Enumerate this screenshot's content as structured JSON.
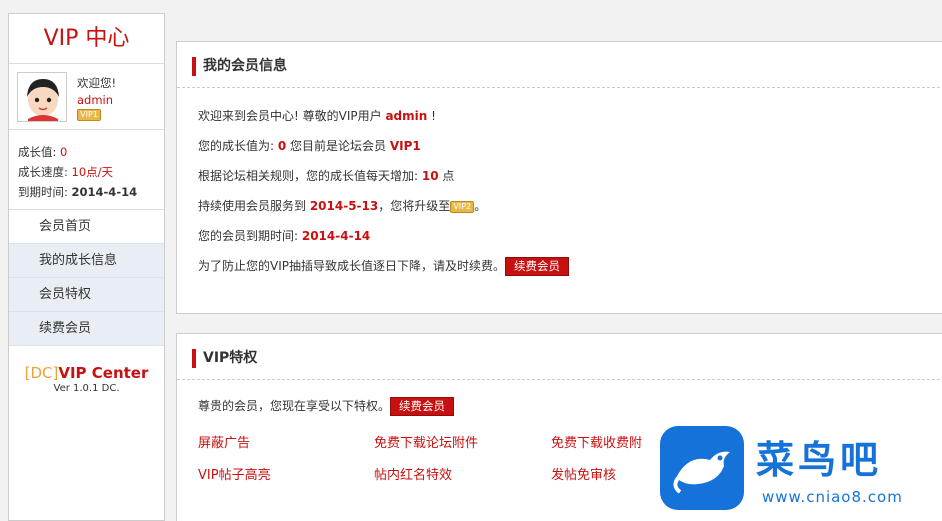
{
  "sidebar": {
    "title": "VIP 中心",
    "welcome": "欢迎您!",
    "username": "admin",
    "badge": "VIP1",
    "stats": {
      "growth_label": "成长值:",
      "growth_value": "0",
      "speed_label": "成长速度:",
      "speed_value": "10点/天",
      "expire_label": "到期时间:",
      "expire_value": "2014-4-14"
    },
    "menu": [
      {
        "label": "会员首页"
      },
      {
        "label": "我的成长信息"
      },
      {
        "label": "会员特权"
      },
      {
        "label": "续费会员"
      }
    ],
    "brand_prefix": "[DC]",
    "brand_name": "VIP Center",
    "version": "Ver 1.0.1 DC."
  },
  "info_panel": {
    "title": "我的会员信息",
    "l1_a": "欢迎来到会员中心! 尊敬的VIP用户 ",
    "l1_user": "admin",
    "l1_b": " !",
    "l2_a": "您的成长值为: ",
    "l2_value": "0",
    "l2_b": " 您目前是论坛会员 ",
    "l2_level": "VIP1",
    "l3_a": "根据论坛相关规则，您的成长值每天增加: ",
    "l3_value": "10",
    "l3_b": " 点",
    "l4_a": "持续使用会员服务到 ",
    "l4_date": "2014-5-13",
    "l4_b": "，您将升级至",
    "l4_badge": "VIP2",
    "l4_c": "。",
    "l5_a": "您的会员到期时间: ",
    "l5_date": "2014-4-14",
    "l6_a": "为了防止您的VIP抽插导致成长值逐日下降，请及时续费。",
    "renew_button": "续费会员"
  },
  "vip_panel": {
    "title": "VIP特权",
    "intro": "尊贵的会员，您现在享受以下特权。",
    "renew_button": "续费会员",
    "privileges": [
      "屏蔽广告",
      "免费下载论坛附件",
      "免费下载收费附",
      "VIP帖子高亮",
      "帖内红名特效",
      "发帖免审核"
    ]
  },
  "watermark": {
    "text": "菜鸟吧",
    "url": "www.cniao8.com"
  },
  "colors": {
    "accent": "#c81010",
    "brand_prefix": "#e8a33a",
    "watermark": "#1572d8"
  }
}
